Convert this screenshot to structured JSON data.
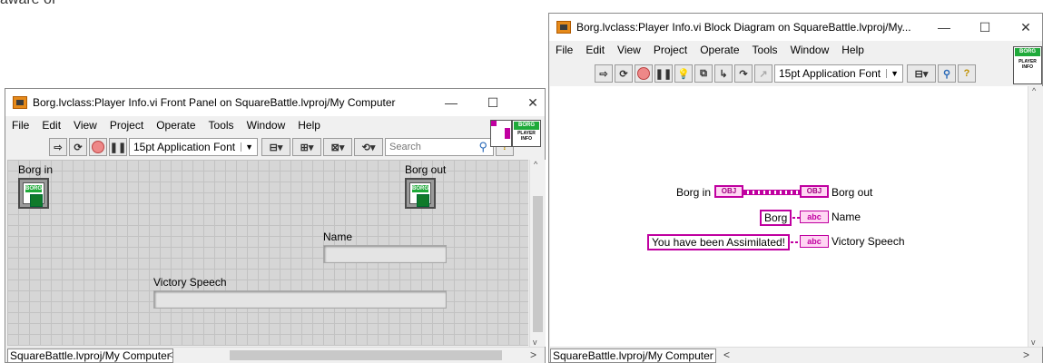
{
  "background_text": "aware of",
  "front_panel": {
    "title": "Borg.lvclass:Player Info.vi Front Panel on SquareBattle.lvproj/My Computer",
    "menu": [
      "File",
      "Edit",
      "View",
      "Project",
      "Operate",
      "Tools",
      "Window",
      "Help"
    ],
    "font": "15pt Application Font",
    "search_placeholder": "Search",
    "labels": {
      "borg_in": "Borg in",
      "borg_out": "Borg out",
      "name": "Name",
      "victory_speech": "Victory Speech"
    },
    "status_path": "SquareBattle.lvproj/My Computer",
    "icon_text": {
      "top": "BORG",
      "bottom": "PLAYER INFO"
    }
  },
  "block_diagram": {
    "title": "Borg.lvclass:Player Info.vi Block Diagram on SquareBattle.lvproj/My...",
    "menu": [
      "File",
      "Edit",
      "View",
      "Project",
      "Operate",
      "Tools",
      "Window",
      "Help"
    ],
    "font": "15pt Application Font",
    "nodes": {
      "borg_in_label": "Borg in",
      "obj_tag": "OBJ",
      "borg_out_label": "Borg out",
      "borg_const": "Borg",
      "name_label": "Name",
      "speech_const": "You have been Assimilated!",
      "speech_label": "Victory Speech",
      "abc_tag": "abc"
    },
    "status_path": "SquareBattle.lvproj/My Computer",
    "icon_text": {
      "top": "BORG",
      "bottom": "PLAYER INFO"
    }
  },
  "window_buttons": {
    "minimize": "—",
    "maximize": "☐",
    "close": "✕"
  },
  "colors": {
    "class_wire": "#c000a0",
    "borg_green": "#1faa3a"
  }
}
